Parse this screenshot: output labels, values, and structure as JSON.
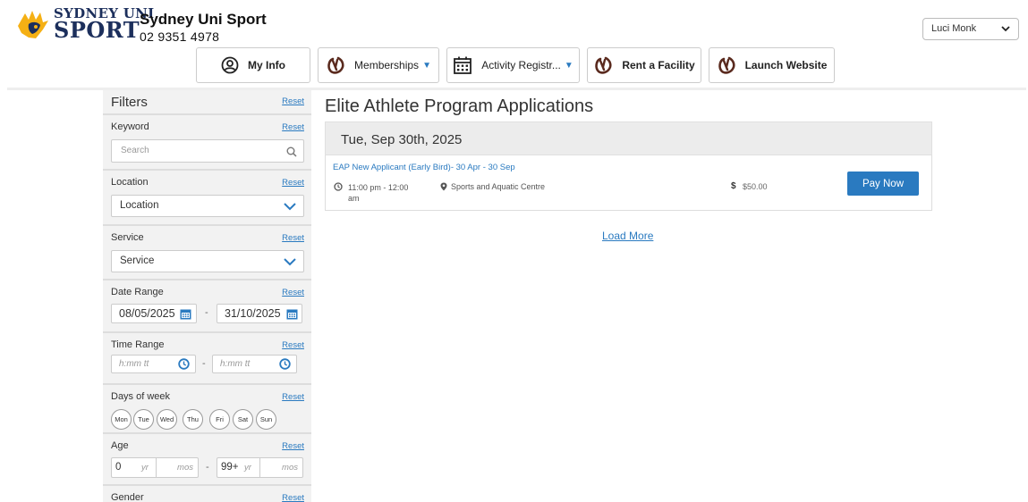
{
  "header": {
    "logo_line1": "SYDNEY UNI",
    "logo_line2": "SPORT",
    "brand_name": "Sydney Uni Sport",
    "phone": "02 9351 4978",
    "user_name": "Luci Monk"
  },
  "nav": [
    {
      "label": "My Info",
      "icon": "user-circle-icon"
    },
    {
      "label": "Memberships",
      "icon": "brand-swirl-icon",
      "caret": "▼"
    },
    {
      "label": "Activity Registr...",
      "icon": "calendar-icon",
      "caret": "▼"
    },
    {
      "label": "Rent a Facility",
      "icon": "brand-swirl-icon"
    },
    {
      "label": "Launch Website",
      "icon": "brand-swirl-icon"
    }
  ],
  "filters": {
    "title": "Filters",
    "reset": "Reset",
    "keyword": {
      "label": "Keyword",
      "placeholder": "Search"
    },
    "location": {
      "label": "Location",
      "value": "Location"
    },
    "service": {
      "label": "Service",
      "value": "Service"
    },
    "date_range": {
      "label": "Date Range",
      "from": "08/05/2025",
      "to": "31/10/2025",
      "separator": "-"
    },
    "time_range": {
      "label": "Time Range",
      "from_placeholder": "h:mm tt",
      "to_placeholder": "h:mm tt",
      "separator": "-"
    },
    "days_of_week": {
      "label": "Days of week",
      "days": [
        "Mon",
        "Tue",
        "Wed",
        "Thu",
        "Fri",
        "Sat",
        "Sun"
      ]
    },
    "age": {
      "label": "Age",
      "min_years": "0",
      "max_years": "99+",
      "yr_unit": "yr",
      "mos_unit": "mos",
      "separator": "-"
    },
    "gender": {
      "label": "Gender"
    }
  },
  "main": {
    "title": "Elite Athlete Program Applications",
    "date_heading": "Tue, Sep 30th, 2025",
    "item": {
      "title": "EAP New Applicant (Early Bird)- 30 Apr - 30 Sep",
      "time": "11:00 pm - 12:00 am",
      "location": "Sports and Aquatic Centre",
      "currency": "$",
      "price": "$50.00",
      "button": "Pay Now"
    },
    "load_more": "Load More"
  },
  "colors": {
    "accent": "#2a7ac0",
    "logo_navy": "#1c2f5c",
    "logo_gold": "#f5b014",
    "brand_swirl": "#5a2a1e",
    "sidebar_bg": "#f2f2f2"
  }
}
